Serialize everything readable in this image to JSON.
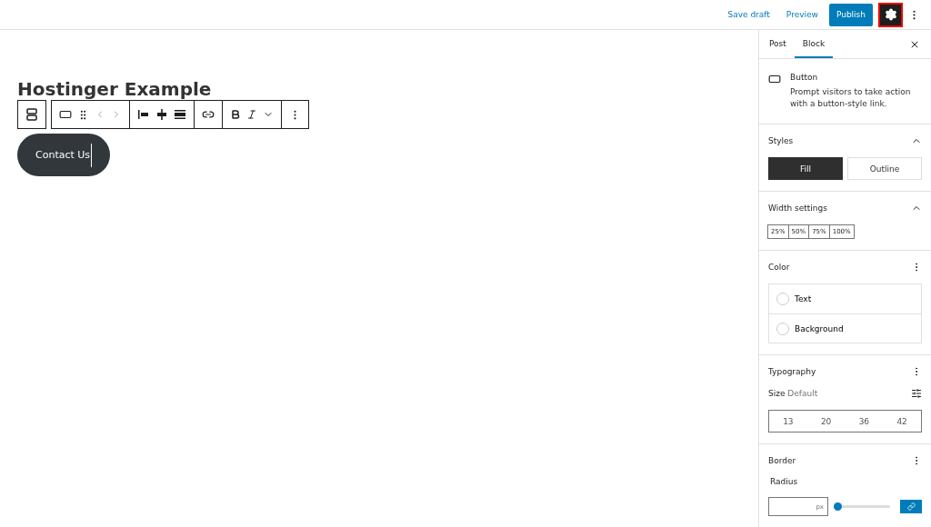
{
  "top_bar": {
    "save_draft": "Save draft",
    "preview": "Preview",
    "publish": "Publish",
    "settings_selected": true
  },
  "editor": {
    "title": "Hostinger Example",
    "button_text": "Contact Us"
  },
  "sidebar": {
    "tabs": [
      {
        "label": "Post",
        "selected": false
      },
      {
        "label": "Block",
        "selected": true
      }
    ],
    "block": {
      "name": "Button",
      "description": "Prompt visitors to take action with a button-style link."
    },
    "styles": {
      "title": "Styles",
      "options": [
        {
          "label": "Fill",
          "selected": true
        },
        {
          "label": "Outline",
          "selected": false
        }
      ]
    },
    "width": {
      "title": "Width settings",
      "options": [
        {
          "label": "25%",
          "selected": false
        },
        {
          "label": "50%",
          "selected": false
        },
        {
          "label": "75%",
          "selected": false
        },
        {
          "label": "100%",
          "selected": false
        }
      ]
    },
    "color": {
      "title": "Color",
      "items": [
        "Text",
        "Background"
      ]
    },
    "typography": {
      "title": "Typography",
      "size_label": "Size",
      "size_value": "Default",
      "sizes": [
        "13",
        "20",
        "36",
        "42"
      ]
    },
    "border": {
      "title": "Border",
      "radius_label": "Radius",
      "unit": "px",
      "level": 0
    }
  }
}
